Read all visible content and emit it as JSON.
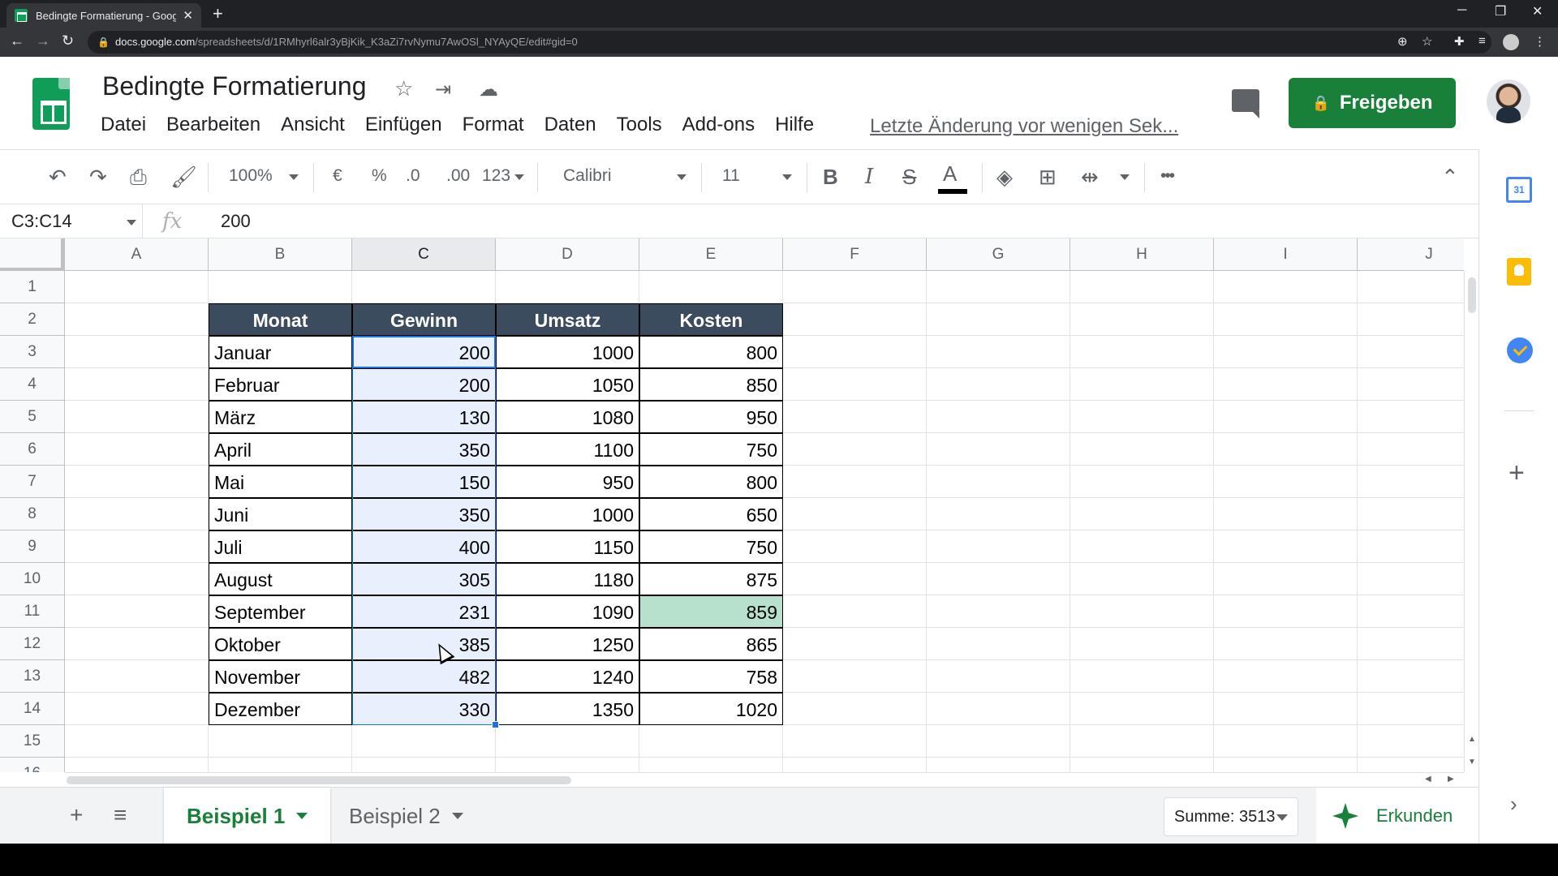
{
  "browser": {
    "tab_title": "Bedingte Formatierung - Google",
    "url_host": "docs.google.com",
    "url_path": "/spreadsheets/d/1RMhyrl6alr3yBjKik_K3aZi7rvNymu7AwOSl_NYAyQE/edit#gid=0"
  },
  "doc": {
    "title": "Bedingte Formatierung",
    "menu": [
      "Datei",
      "Bearbeiten",
      "Ansicht",
      "Einfügen",
      "Format",
      "Daten",
      "Tools",
      "Add-ons",
      "Hilfe"
    ],
    "last_edit": "Letzte Änderung vor wenigen Sek...",
    "share_label": "Freigeben"
  },
  "toolbar": {
    "zoom": "100%",
    "currency": "€",
    "percent": "%",
    "dec_less": ".0",
    "dec_more": ".00",
    "number_format": "123",
    "font": "Calibri",
    "font_size": "11",
    "bold": "B",
    "italic": "I",
    "strike": "S",
    "text_color": "A",
    "more": "•••"
  },
  "formula_bar": {
    "name_box": "C3:C14",
    "fx": "fx",
    "value": "200"
  },
  "sheet": {
    "columns": [
      "A",
      "B",
      "C",
      "D",
      "E",
      "F",
      "G",
      "H",
      "I",
      "J"
    ],
    "rows": [
      "1",
      "2",
      "3",
      "4",
      "5",
      "6",
      "7",
      "8",
      "9",
      "10",
      "11",
      "12",
      "13",
      "14",
      "15",
      "16"
    ],
    "table_header": [
      "Monat",
      "Gewinn",
      "Umsatz",
      "Kosten"
    ],
    "table_rows": [
      [
        "Januar",
        "200",
        "1000",
        "800"
      ],
      [
        "Februar",
        "200",
        "1050",
        "850"
      ],
      [
        "März",
        "130",
        "1080",
        "950"
      ],
      [
        "April",
        "350",
        "1100",
        "750"
      ],
      [
        "Mai",
        "150",
        "950",
        "800"
      ],
      [
        "Juni",
        "350",
        "1000",
        "650"
      ],
      [
        "Juli",
        "400",
        "1150",
        "750"
      ],
      [
        "August",
        "305",
        "1180",
        "875"
      ],
      [
        "September",
        "231",
        "1090",
        "859"
      ],
      [
        "Oktober",
        "385",
        "1250",
        "865"
      ],
      [
        "November",
        "482",
        "1240",
        "758"
      ],
      [
        "Dezember",
        "330",
        "1350",
        "1020"
      ]
    ],
    "highlight_color": "#b7e1cd",
    "header_color": "#3c4c5f"
  },
  "sheet_tabs": {
    "tabs": [
      "Beispiel 1",
      "Beispiel 2"
    ],
    "active": "Beispiel 1",
    "sum": "Summe: 3513",
    "explore": "Erkunden"
  },
  "side_panel": {
    "calendar_day": "31"
  }
}
